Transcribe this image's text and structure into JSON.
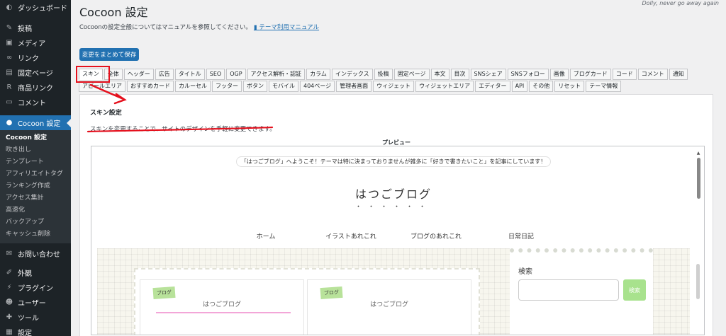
{
  "top": {
    "dolly": "Dolly, never go away again"
  },
  "sidebar": {
    "items_top": [
      {
        "label": "ダッシュボード",
        "icon": "dashboard-icon",
        "glyph": "◐"
      },
      {
        "label": "投稿",
        "icon": "pin-icon",
        "glyph": "✎"
      },
      {
        "label": "メディア",
        "icon": "media-icon",
        "glyph": "▣"
      },
      {
        "label": "リンク",
        "icon": "link-icon",
        "glyph": "∞"
      },
      {
        "label": "固定ページ",
        "icon": "page-icon",
        "glyph": "▤"
      },
      {
        "label": "商品リンク",
        "icon": "r-icon",
        "glyph": "R"
      },
      {
        "label": "コメント",
        "icon": "comment-icon",
        "glyph": "▭"
      }
    ],
    "active_item": {
      "label": "Cocoon 設定",
      "icon": "cocoon-icon",
      "glyph": "●"
    },
    "submenu": [
      "Cocoon 設定",
      "吹き出し",
      "テンプレート",
      "アフィリエイトタグ",
      "ランキング作成",
      "アクセス集計",
      "高速化",
      "バックアップ",
      "キャッシュ削除"
    ],
    "items_bottom": [
      {
        "label": "お問い合わせ",
        "icon": "mail-icon",
        "glyph": "✉"
      },
      {
        "label": "外観",
        "icon": "brush-icon",
        "glyph": "✐"
      },
      {
        "label": "プラグイン",
        "icon": "plugin-icon",
        "glyph": "⚡"
      },
      {
        "label": "ユーザー",
        "icon": "user-icon",
        "glyph": "☻"
      },
      {
        "label": "ツール",
        "icon": "wrench-icon",
        "glyph": "✚"
      },
      {
        "label": "設定",
        "icon": "settings-icon",
        "glyph": "▦"
      }
    ]
  },
  "header": {
    "title": "Cocoon 設定",
    "manual_text": "Cocoonの設定全般についてはマニュアルを参照してください。",
    "manual_link": "テーマ利用マニュアル",
    "manual_link_icon": "book-icon",
    "save_label": "変更をまとめて保存"
  },
  "tabs": {
    "row1": [
      "スキン",
      "全体",
      "ヘッダー",
      "広告",
      "タイトル",
      "SEO",
      "OGP",
      "アクセス解析・認証",
      "カラム",
      "インデックス",
      "投稿",
      "固定ページ",
      "本文",
      "目次",
      "SNSシェア",
      "SNSフォロー",
      "画像",
      "ブログカード",
      "コード",
      "コメント",
      "通知"
    ],
    "row2": [
      "アピールエリア",
      "おすすめカード",
      "カルーセル",
      "フッター",
      "ボタン",
      "モバイル",
      "404ページ",
      "管理者画面",
      "ウィジェット",
      "ウィジェットエリア",
      "エディター",
      "API",
      "その他",
      "リセット",
      "テーマ情報"
    ],
    "active": "スキン"
  },
  "panel": {
    "heading": "スキン設定",
    "description": "スキンを変更することで、サイトのデザインを手軽に変更できます。",
    "preview_label": "プレビュー"
  },
  "preview": {
    "notice": "「はつごブログ」へようこそ！テーマは特に決まっておりませんが雑多に「好きで書きたいこと」を記事にしています！",
    "site_name": "はつごブログ",
    "dots": "・・・・・・",
    "nav": [
      "ホーム",
      "イラストあれこれ",
      "ブログのあれこれ",
      "日常日記"
    ],
    "cards": [
      {
        "category": "ブログ",
        "title": "はつごブログ"
      },
      {
        "category": "ブログ",
        "title": "はつごブログ"
      }
    ],
    "search_label": "検索",
    "search_button": "検索"
  },
  "colors": {
    "sidebar_bg": "#1d2327",
    "accent": "#2271b1",
    "annotation": "#e5101d",
    "category_badge": "#b8e29a",
    "search_button": "#a8e28d"
  }
}
